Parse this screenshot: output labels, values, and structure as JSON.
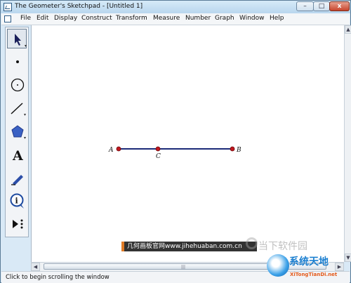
{
  "window": {
    "title": "The Geometer's Sketchpad - [Untitled 1]",
    "buttons": {
      "minimize": "–",
      "maximize": "□",
      "close": "x"
    }
  },
  "menu": [
    "File",
    "Edit",
    "Display",
    "Construct",
    "Transform",
    "Measure",
    "Number",
    "Graph",
    "Window",
    "Help"
  ],
  "tools": [
    {
      "name": "arrow-tool",
      "icon": "arrow-icon"
    },
    {
      "name": "point-tool",
      "icon": "point-icon"
    },
    {
      "name": "compass-tool",
      "icon": "circle-icon"
    },
    {
      "name": "straightedge-tool",
      "icon": "line-icon"
    },
    {
      "name": "polygon-tool",
      "icon": "pentagon-icon"
    },
    {
      "name": "text-tool",
      "icon": "text-A-icon",
      "label": "A"
    },
    {
      "name": "marker-tool",
      "icon": "pen-icon"
    },
    {
      "name": "information-tool",
      "icon": "info-icon",
      "label": "i"
    },
    {
      "name": "custom-tool",
      "icon": "play-more-icon"
    }
  ],
  "sketch": {
    "points": [
      {
        "label": "A"
      },
      {
        "label": "C"
      },
      {
        "label": "B"
      }
    ],
    "segment_color": "#1c2a78",
    "point_color": "#c0171e"
  },
  "status": {
    "text": "Click to begin scrolling the window"
  },
  "watermarks": {
    "banner": "几何画板官网www.jihehuaban.com.cn",
    "site1": "当下软件园",
    "site2": "系统天地",
    "site2_url": "XiTongTianDi.net"
  }
}
